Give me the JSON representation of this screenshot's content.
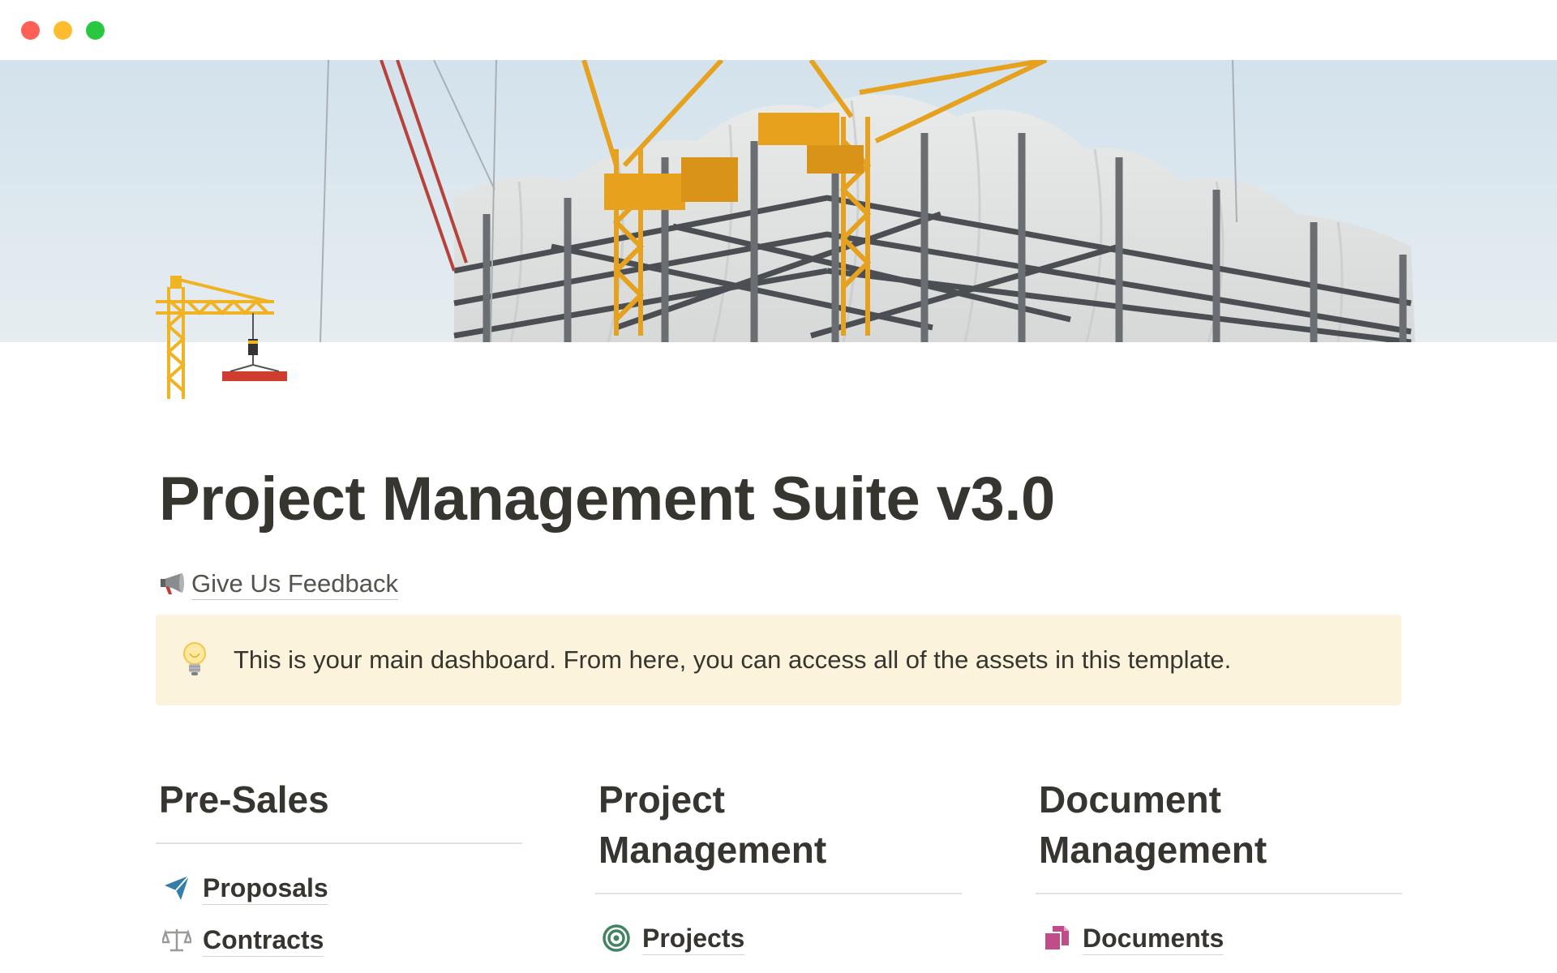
{
  "window": {
    "controls": [
      "close",
      "minimize",
      "zoom"
    ]
  },
  "cover": {
    "image": "construction-site-cranes-photo"
  },
  "page": {
    "icon": "building-construction-crane-icon",
    "title": "Project Management Suite v3.0"
  },
  "feedback": {
    "icon": "megaphone-icon",
    "label": "Give Us Feedback"
  },
  "callout": {
    "icon": "light-bulb-icon",
    "text": "This is your main dashboard.  From here, you can access all of the assets in this template.",
    "background": "#fbf3db"
  },
  "columns": [
    {
      "heading": "Pre-Sales",
      "items": [
        {
          "label": "Proposals",
          "icon": "paper-plane-icon",
          "color": "#337ea9"
        },
        {
          "label": "Contracts",
          "icon": "scales-icon",
          "color": "#9b9a97"
        }
      ]
    },
    {
      "heading": "Project\nManagement",
      "items": [
        {
          "label": "Projects",
          "icon": "target-icon",
          "color": "#448361"
        }
      ]
    },
    {
      "heading": "Document\nManagement",
      "items": [
        {
          "label": "Documents",
          "icon": "documents-icon",
          "color": "#c14c8a"
        }
      ]
    }
  ]
}
